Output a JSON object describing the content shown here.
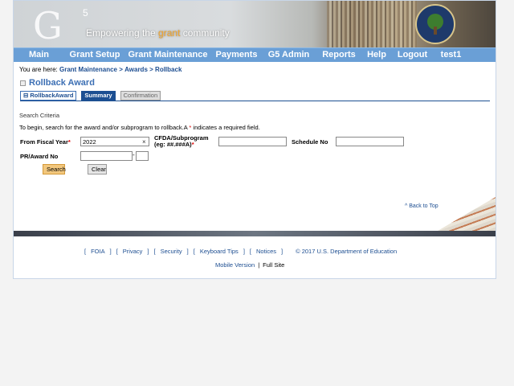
{
  "banner": {
    "logo_letter": "G",
    "logo_number": "5",
    "tagline_pre": "Empowering the ",
    "tagline_highlight": "grant",
    "tagline_post": " community"
  },
  "nav": {
    "items": [
      "Main",
      "Grant Setup",
      "Grant Maintenance",
      "Payments",
      "G5 Admin",
      "Reports",
      "Help",
      "Logout",
      "test1"
    ]
  },
  "breadcrumb": {
    "prefix": "You are here:",
    "items": [
      "Grant Maintenance",
      ">",
      "Awards",
      ">",
      "Rollback"
    ]
  },
  "page": {
    "title": "Rollback Award"
  },
  "tabs": [
    {
      "label": "RollbackAward"
    },
    {
      "label": "Summary"
    },
    {
      "label": "Confirmation"
    }
  ],
  "form": {
    "section_title": "Search Criteria",
    "instructions": "To begin, search for the award and/or subprogram to rollback.A",
    "required_mark": "*",
    "required_note": " indicates a required field.",
    "fiscal_year_label": "From Fiscal Year",
    "fiscal_year_value": "2022",
    "clear_symbol": "×",
    "cfda_label_line1": "CFDA/Subprogram",
    "cfda_label_line2": "(eg: ##.###A)",
    "cfda_value": "",
    "schedule_label": "Schedule No",
    "schedule_value": "",
    "pr_award_label": "PR/Award No",
    "pr_award_value": "",
    "pr_award_dash": "-",
    "pr_award_suffix_value": "",
    "search_button": "Search",
    "clear_button": "Clear"
  },
  "back_to_top": "^ Back to Top",
  "footer": {
    "links": [
      "FOIA",
      "Privacy",
      "Security",
      "Keyboard Tips",
      "Notices"
    ],
    "copyright": "© 2017 U.S. Department of Education",
    "mobile_version": "Mobile Version",
    "divider": "|",
    "full_site": "Full Site"
  },
  "colors": {
    "nav_bar": "#6a9fd6",
    "title_blue": "#3c6fb4",
    "link_blue": "#1d4e91",
    "active_tab": "#1c4f92",
    "search_button": "#f2c77d",
    "required": "#dd0000"
  }
}
